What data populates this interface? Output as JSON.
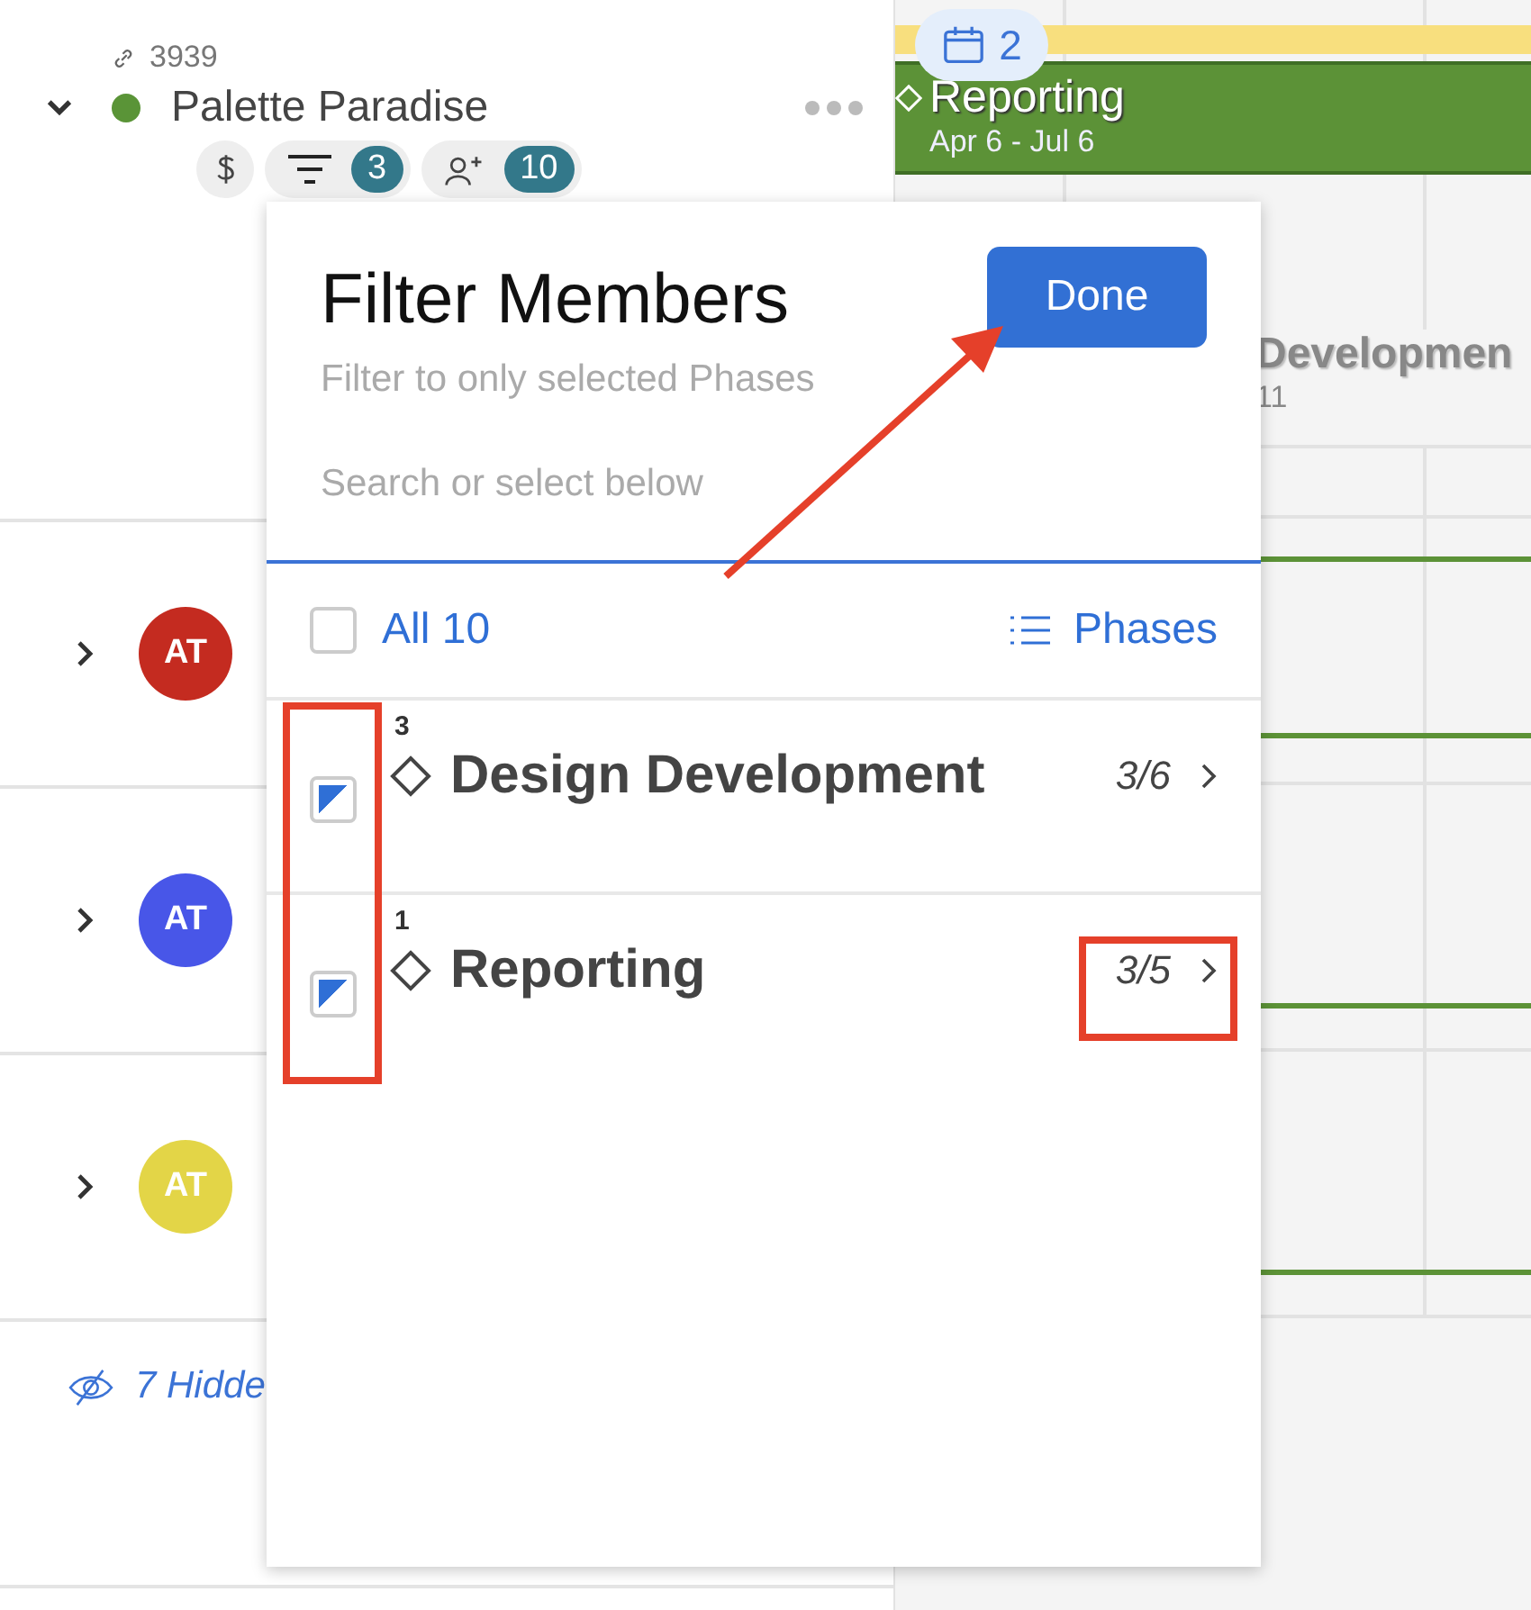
{
  "project": {
    "id": "3939",
    "name": "Palette Paradise",
    "expanded": true,
    "color": "#5a9437",
    "filter_count": "3",
    "member_count": "10"
  },
  "members": [
    {
      "initials": "AT",
      "color": "#c42b20",
      "expanded": false
    },
    {
      "initials": "AT",
      "color": "#4856e8",
      "expanded": false
    },
    {
      "initials": "AT",
      "color": "#e3d547",
      "expanded": false
    }
  ],
  "hidden_link": "7 Hidde",
  "timeline": {
    "calendar_count": "2",
    "phase": {
      "title": "Reporting",
      "dates": "Apr 6 - Jul 6"
    },
    "behind_phase": {
      "title": "Developmen",
      "dates": "11"
    }
  },
  "filter_popup": {
    "title": "Filter Members",
    "done": "Done",
    "subtitle": "Filter to only selected Phases",
    "search": {
      "placeholder": "Search or select below"
    },
    "all": {
      "label": "All 10",
      "partial": false
    },
    "group_by": "Phases",
    "phases": [
      {
        "count": "3",
        "name": "Design Development",
        "ratio": "3/6",
        "partial": true
      },
      {
        "count": "1",
        "name": "Reporting",
        "ratio": "3/5",
        "partial": true
      }
    ]
  },
  "annotations": [
    {
      "kind": "box"
    },
    {
      "kind": "box"
    },
    {
      "kind": "arrow"
    }
  ]
}
